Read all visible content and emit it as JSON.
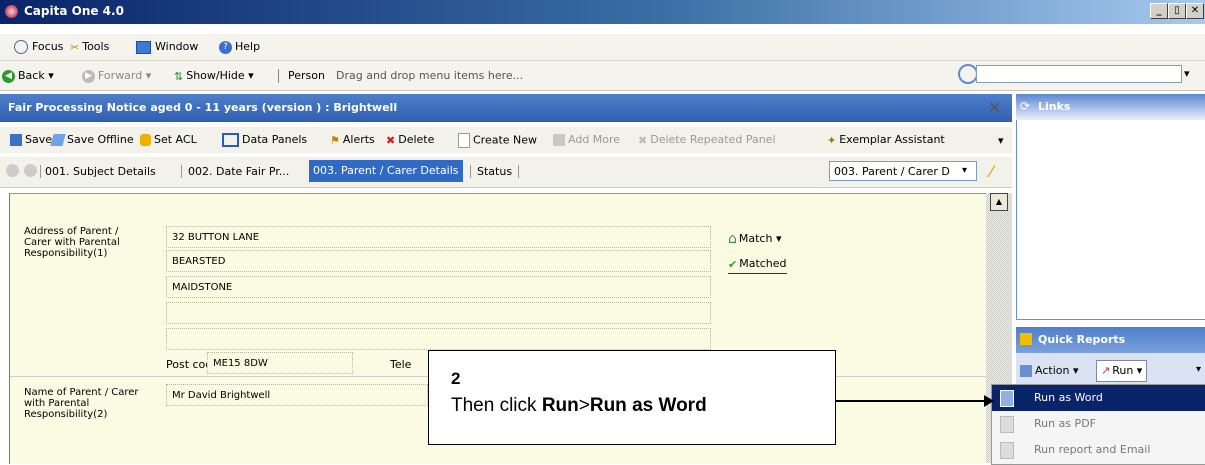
{
  "window": {
    "title": "Capita One 4.0"
  },
  "menu": {
    "focus": "Focus",
    "tools": "Tools",
    "window": "Window",
    "help": "Help"
  },
  "nav": {
    "back": "Back",
    "forward": "Forward",
    "show_hide": "Show/Hide",
    "person": "Person",
    "hint": "Drag and drop menu items here..."
  },
  "form": {
    "title": "Fair Processing Notice aged 0 - 11 years (version ) : Brightwell",
    "toolbar": {
      "save": "Save",
      "save_offline": "Save Offline",
      "set_acl": "Set ACL",
      "data_panels": "Data Panels",
      "alerts": "Alerts",
      "delete": "Delete",
      "create_new": "Create New",
      "add_more": "Add More",
      "delete_repeated": "Delete Repeated Panel",
      "exemplar": "Exemplar Assistant"
    },
    "tabs": [
      "001. Subject Details",
      "002. Date Fair Pr...",
      "003. Parent / Carer Details",
      "Status"
    ],
    "tab_select": "003. Parent / Carer D",
    "address_label": "Address of Parent / Carer with Parental Responsibility(1)",
    "address_lines": [
      "32 BUTTON  LANE",
      "BEARSTED",
      "MAIDSTONE",
      "",
      ""
    ],
    "match": "Match",
    "matched": "Matched",
    "postcode_label": "Post code",
    "postcode": "ME15  8DW",
    "tele_label": "Tele",
    "name_label": "Name of Parent / Carer with Parental Responsibility(2)",
    "name_value": "Mr David Brightwell"
  },
  "panels": {
    "links": "Links",
    "quick_reports": "Quick Reports",
    "action": "Action",
    "run": "Run",
    "run_menu": [
      "Run as Word",
      "Run as PDF",
      "Run report and Email"
    ]
  },
  "callout": {
    "step": "2",
    "text_prefix": "Then click ",
    "run": "Run",
    "sep": ">",
    "run_as_word": "Run as Word"
  },
  "colors": {
    "accent": "#0a246a",
    "form_bg": "#fbfbe3",
    "highlight": "#0a246a",
    "tab_active": "#316ac5"
  }
}
